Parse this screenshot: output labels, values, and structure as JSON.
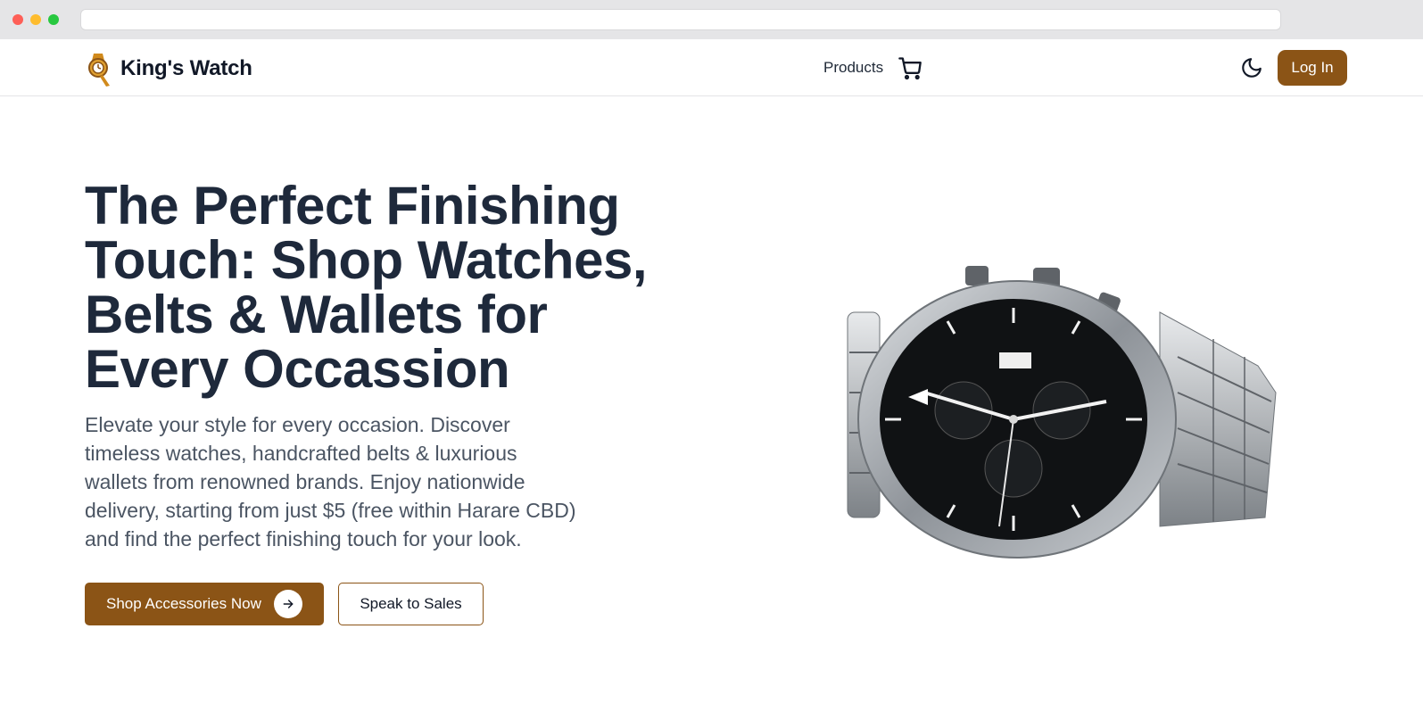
{
  "brand": {
    "name": "King's Watch",
    "logo_icon": "watch-logo-icon"
  },
  "nav": {
    "products_label": "Products",
    "cart_icon": "cart-icon",
    "theme_icon": "moon-icon",
    "login_label": "Log In"
  },
  "hero": {
    "headline_lines": [
      "The Perfect Finishing",
      "Touch: Shop Watches,",
      "Belts & Wallets for",
      "Every Occassion"
    ],
    "subtext_lines": [
      "Elevate your style for every occasion. Discover",
      "timeless watches, handcrafted belts & luxurious",
      "wallets from renowned brands. Enjoy nationwide",
      "delivery, starting from just $5 (free within Harare CBD)",
      "and find the perfect finishing touch for your look."
    ],
    "primary_cta": "Shop Accessories Now",
    "secondary_cta": "Speak to Sales",
    "image_alt": "chronograph-watch-image"
  },
  "colors": {
    "accent": "#8b5416",
    "heading": "#1e293b",
    "body": "#4b5563"
  }
}
